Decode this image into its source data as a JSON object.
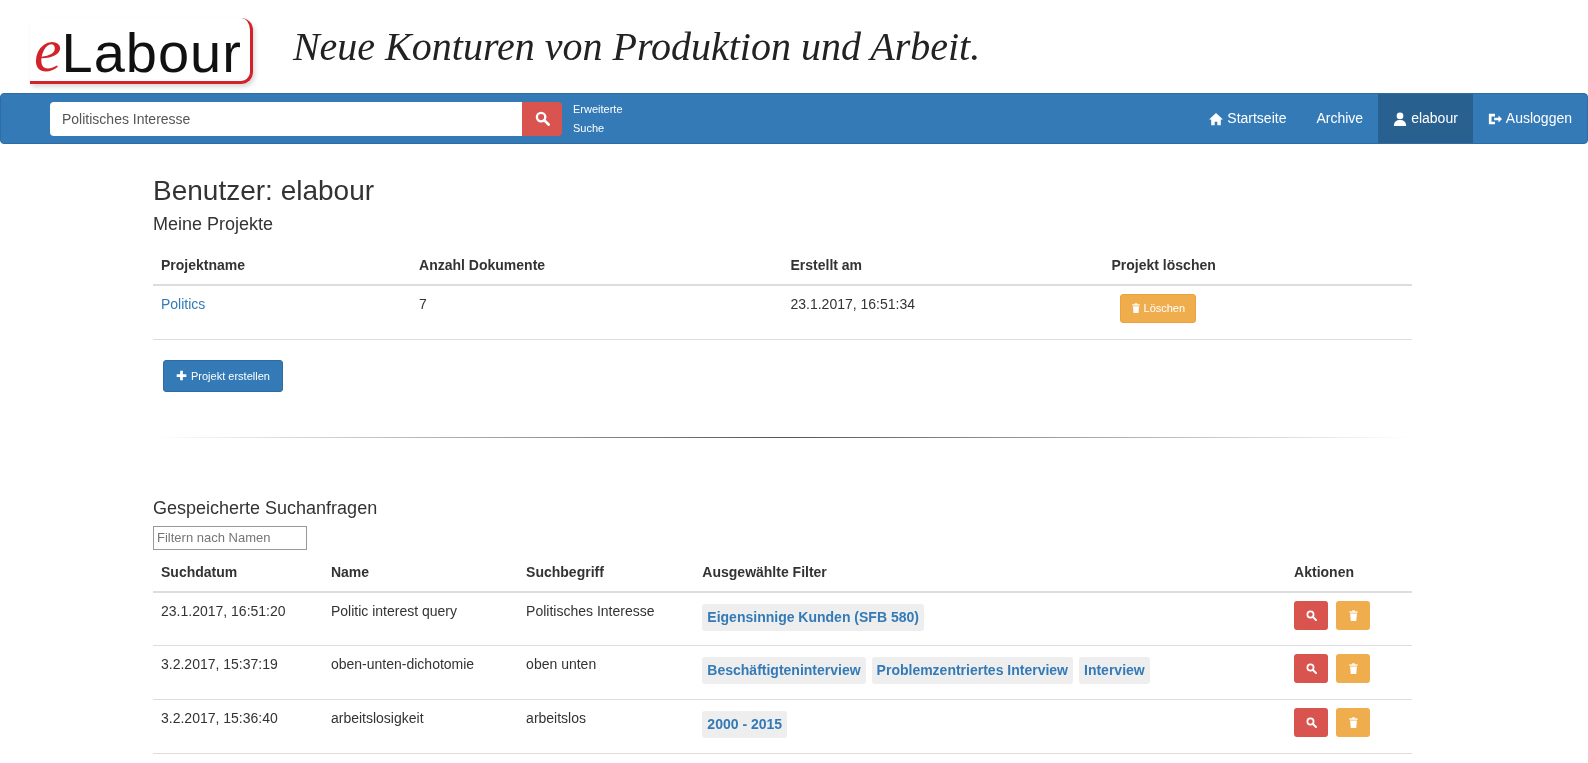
{
  "header": {
    "logo_prefix": "e",
    "logo_name": "Labour",
    "tagline": "Neue Konturen von Produktion und Arbeit."
  },
  "navbar": {
    "search_value": "Politisches Interesse",
    "advanced_search": [
      "Erweiterte",
      "Suche"
    ],
    "links": [
      {
        "label": "Startseite",
        "selected": false
      },
      {
        "label": "Archive",
        "selected": false
      },
      {
        "label": "elabour",
        "selected": true
      },
      {
        "label": "Ausloggen",
        "selected": false
      }
    ]
  },
  "page_title": "Benutzer: elabour",
  "projects": {
    "heading": "Meine Projekte",
    "columns": [
      "Projektname",
      "Anzahl Dokumente",
      "Erstellt am",
      "Projekt löschen"
    ],
    "rows": [
      {
        "name": "Politics",
        "documents": "7",
        "created": "23.1.2017, 16:51:34",
        "delete_label": "Löschen"
      }
    ],
    "create_button": "Projekt erstellen"
  },
  "saved_queries": {
    "heading": "Gespeicherte Suchanfragen",
    "filter_placeholder": "Filtern nach Namen",
    "columns": [
      "Suchdatum",
      "Name",
      "Suchbegriff",
      "Ausgewählte Filter",
      "Aktionen"
    ],
    "rows": [
      {
        "date": "23.1.2017, 16:51:20",
        "name": "Politic interest query",
        "term": "Politisches Interesse",
        "filters": [
          "Eigensinnige Kunden (SFB 580)"
        ]
      },
      {
        "date": "3.2.2017, 15:37:19",
        "name": "oben-unten-dichotomie",
        "term": "oben unten",
        "filters": [
          "Beschäftigteninterview",
          "Problemzentriertes Interview",
          "Interview"
        ]
      },
      {
        "date": "3.2.2017, 15:36:40",
        "name": "arbeitslosigkeit",
        "term": "arbeitslos",
        "filters": [
          "2000 - 2015"
        ]
      }
    ]
  }
}
